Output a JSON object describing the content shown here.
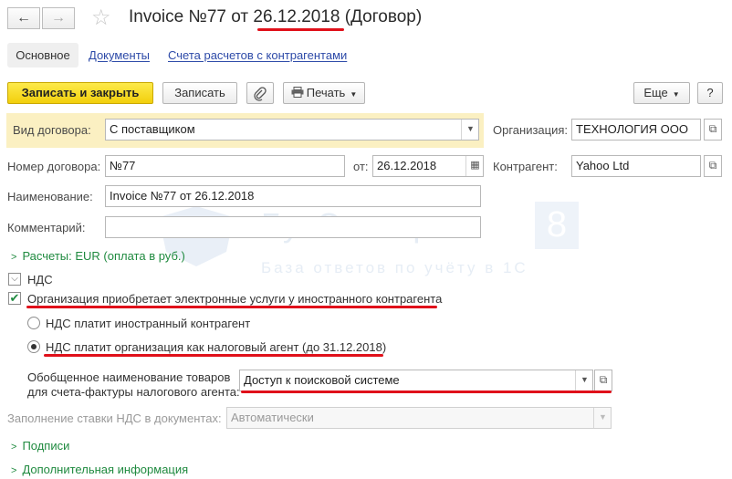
{
  "title": {
    "prefix": "Invoice №77 от ",
    "date": "26.12.2018",
    "suffix": " (Договор)"
  },
  "tabs": [
    "Основное",
    "Документы",
    "Счета расчетов с контрагентами"
  ],
  "toolbar": {
    "save_close": "Записать и закрыть",
    "save": "Записать",
    "print": "Печать",
    "more": "Еще",
    "help": "?"
  },
  "form": {
    "contract_type_label": "Вид договора:",
    "contract_type_value": "С поставщиком",
    "organization_label": "Организация:",
    "organization_value": "ТЕХНОЛОГИЯ ООО",
    "contract_number_label": "Номер договора:",
    "contract_number_value": "№77",
    "date_label": "от:",
    "date_value": "26.12.2018",
    "counterparty_label": "Контрагент:",
    "counterparty_value": "Yahoo Ltd",
    "name_label": "Наименование:",
    "name_value": "Invoice №77 от 26.12.2018",
    "comment_label": "Комментарий:",
    "comment_value": ""
  },
  "settlements": "Расчеты: EUR (оплата в руб.)",
  "vat": {
    "section_label": "НДС",
    "electronic_services_label": "Организация приобретает электронные услуги у иностранного контрагента",
    "electronic_services_checked": true,
    "radio_foreign": "НДС платит иностранный контрагент",
    "radio_agent": "НДС платит организация как налоговый агент (до 31.12.2018)",
    "selected": "agent",
    "goods_name_label_line1": "Обобщенное наименование товаров",
    "goods_name_label_line2": "для счета-фактуры налогового агента:",
    "goods_name_value": "Доступ к поисковой системе",
    "rate_fill_label": "Заполнение ставки НДС в документах:",
    "rate_fill_value": "Автоматически"
  },
  "groups": {
    "signatures": "Подписи",
    "additional": "Дополнительная информация"
  },
  "watermark": {
    "brand": "БухЭксперт",
    "digit": "8",
    "tagline": "База ответов по учёту в 1С"
  },
  "colors": {
    "accent_yellow": "#f2cf0c",
    "group_green": "#1f8a3f",
    "link_blue": "#2d4aa8",
    "annotation_red": "#e0101a",
    "highlight_row": "#fbf0c2"
  }
}
